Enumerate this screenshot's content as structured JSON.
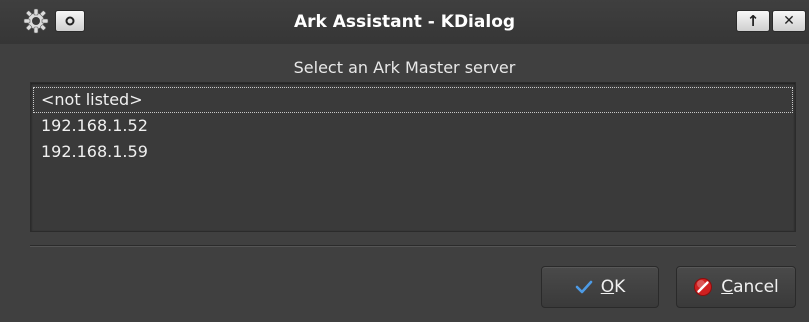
{
  "window": {
    "title": "Ark Assistant - KDialog"
  },
  "titlebar": {
    "icons": [
      "gear-icon",
      "circle-icon",
      "arrow-up-icon",
      "close-icon"
    ],
    "up_glyph": "↑",
    "close_glyph": "✕"
  },
  "dialog": {
    "prompt": "Select an Ark Master server",
    "items": [
      {
        "label": "<not listed>",
        "selected": true
      },
      {
        "label": "192.168.1.52",
        "selected": false
      },
      {
        "label": "192.168.1.59",
        "selected": false
      }
    ]
  },
  "buttons": {
    "ok": {
      "mnemonic": "O",
      "rest": "K",
      "icon": "checkmark-icon"
    },
    "cancel": {
      "mnemonic": "C",
      "rest": "ancel",
      "icon": "cancel-icon"
    }
  },
  "colors": {
    "background": "#404040",
    "text": "#f0f0f0",
    "check": "#4d9be6",
    "cancel_red": "#d02020"
  }
}
